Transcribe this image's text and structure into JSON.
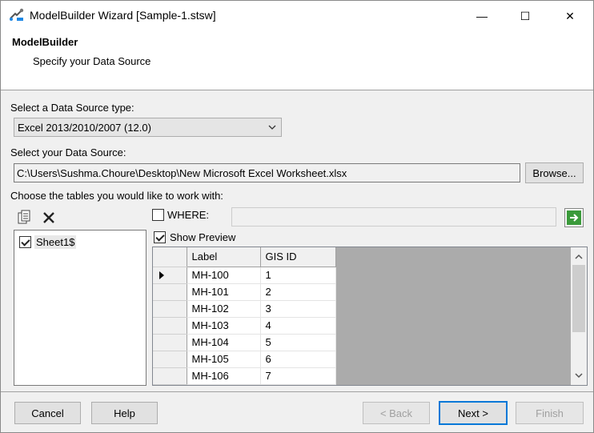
{
  "window": {
    "title": "ModelBuilder Wizard [Sample-1.stsw]",
    "minimize_glyph": "—",
    "maximize_glyph": "☐",
    "close_glyph": "✕"
  },
  "header": {
    "title": "ModelBuilder",
    "subtitle": "Specify your Data Source"
  },
  "source_type": {
    "label": "Select a Data Source type:",
    "selected": "Excel 2013/2010/2007 (12.0)"
  },
  "data_source": {
    "label": "Select your Data Source:",
    "path": "C:\\Users\\Sushma.Choure\\Desktop\\New Microsoft Excel Worksheet.xlsx",
    "browse_label": "Browse..."
  },
  "tables": {
    "label": "Choose the tables you would like to work with:",
    "items": [
      {
        "label": "Sheet1$",
        "checked": true
      }
    ]
  },
  "where": {
    "label": "WHERE:",
    "checked": false,
    "value": ""
  },
  "preview": {
    "label": "Show Preview",
    "checked": true,
    "columns": [
      "Label",
      "GIS ID"
    ],
    "rows": [
      [
        "MH-100",
        "1"
      ],
      [
        "MH-101",
        "2"
      ],
      [
        "MH-102",
        "3"
      ],
      [
        "MH-103",
        "4"
      ],
      [
        "MH-104",
        "5"
      ],
      [
        "MH-105",
        "6"
      ],
      [
        "MH-106",
        "7"
      ]
    ]
  },
  "footer": {
    "cancel": "Cancel",
    "help": "Help",
    "back": "< Back",
    "next": "Next >",
    "finish": "Finish"
  },
  "colors": {
    "accent": "#0078d7",
    "go_arrow": "#2e8b2e"
  }
}
